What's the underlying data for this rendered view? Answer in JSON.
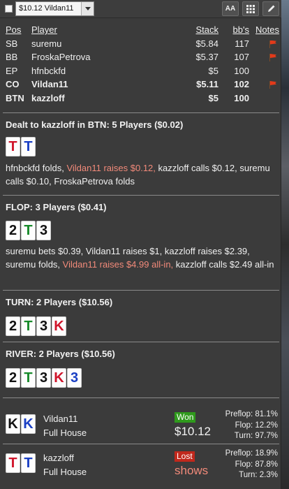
{
  "topbar": {
    "hand_select": "$10.12 Vildan11",
    "font_button_label": "AA"
  },
  "table": {
    "headers": {
      "pos": "Pos",
      "player": "Player",
      "stack": "Stack",
      "bbs": "bb's",
      "notes": "Notes"
    },
    "rows": [
      {
        "pos": "SB",
        "player": "suremu",
        "stack": "$5.84",
        "bbs": "117",
        "note_flag": true,
        "bold": false
      },
      {
        "pos": "BB",
        "player": "FroskaPetrova",
        "stack": "$5.37",
        "bbs": "107",
        "note_flag": true,
        "bold": false
      },
      {
        "pos": "EP",
        "player": "hfnbckfd",
        "stack": "$5",
        "bbs": "100",
        "note_flag": false,
        "bold": false
      },
      {
        "pos": "CO",
        "player": "Vildan11",
        "stack": "$5.11",
        "bbs": "102",
        "note_flag": true,
        "bold": true
      },
      {
        "pos": "BTN",
        "player": "kazzloff",
        "stack": "$5",
        "bbs": "100",
        "note_flag": false,
        "bold": true
      }
    ]
  },
  "preflop": {
    "title": "Dealt to kazzloff in BTN: 5 Players ($0.02)",
    "cards": [
      {
        "rank": "T",
        "color": "#d0142a"
      },
      {
        "rank": "T",
        "color": "#1a3fc4"
      }
    ],
    "actions": [
      {
        "text": "hfnbckfd folds, ",
        "hl": false
      },
      {
        "text": "Vildan11 raises $0.12,",
        "hl": true
      },
      {
        "text": " kazzloff calls $0.12, suremu calls $0.10, FroskaPetrova folds",
        "hl": false
      }
    ]
  },
  "flop": {
    "title": "FLOP: 3 Players ($0.41)",
    "cards": [
      {
        "rank": "2",
        "color": "#111111"
      },
      {
        "rank": "T",
        "color": "#178a2a"
      },
      {
        "rank": "3",
        "color": "#111111"
      }
    ],
    "actions": [
      {
        "text": "suremu bets $0.39, Vildan11 raises $1, kazzloff raises $2.39, suremu folds, ",
        "hl": false
      },
      {
        "text": "Vildan11 raises $4.99 all-in,",
        "hl": true
      },
      {
        "text": " kazzloff calls $2.49 all-in",
        "hl": false
      }
    ]
  },
  "turn": {
    "title": "TURN: 2 Players ($10.56)",
    "cards": [
      {
        "rank": "2",
        "color": "#111111"
      },
      {
        "rank": "T",
        "color": "#178a2a"
      },
      {
        "rank": "3",
        "color": "#111111"
      },
      {
        "rank": "K",
        "color": "#d0142a"
      }
    ]
  },
  "river": {
    "title": "RIVER: 2 Players ($10.56)",
    "cards": [
      {
        "rank": "2",
        "color": "#111111"
      },
      {
        "rank": "T",
        "color": "#178a2a"
      },
      {
        "rank": "3",
        "color": "#111111"
      },
      {
        "rank": "K",
        "color": "#d0142a"
      },
      {
        "rank": "3",
        "color": "#1a3fc4"
      }
    ]
  },
  "results": [
    {
      "name": "Vildan11",
      "hand": "Full House",
      "cards": [
        {
          "rank": "K",
          "color": "#111111"
        },
        {
          "rank": "K",
          "color": "#1a3fc4"
        }
      ],
      "badge": "Won",
      "badge_color": "#2f9a1c",
      "amount": "$10.12",
      "amount_color": "#f2f2f2",
      "preflop": "Preflop: 81.1%",
      "flop": "Flop: 12.2%",
      "turn": "Turn: 97.7%"
    },
    {
      "name": "kazzloff",
      "hand": "Full House",
      "cards": [
        {
          "rank": "T",
          "color": "#d0142a"
        },
        {
          "rank": "T",
          "color": "#1a3fc4"
        }
      ],
      "badge": "Lost",
      "badge_color": "#c0281c",
      "amount": "shows",
      "amount_color": "#f28a7a",
      "preflop": "Preflop: 18.9%",
      "flop": "Flop: 87.8%",
      "turn": "Turn: 2.3%"
    }
  ]
}
